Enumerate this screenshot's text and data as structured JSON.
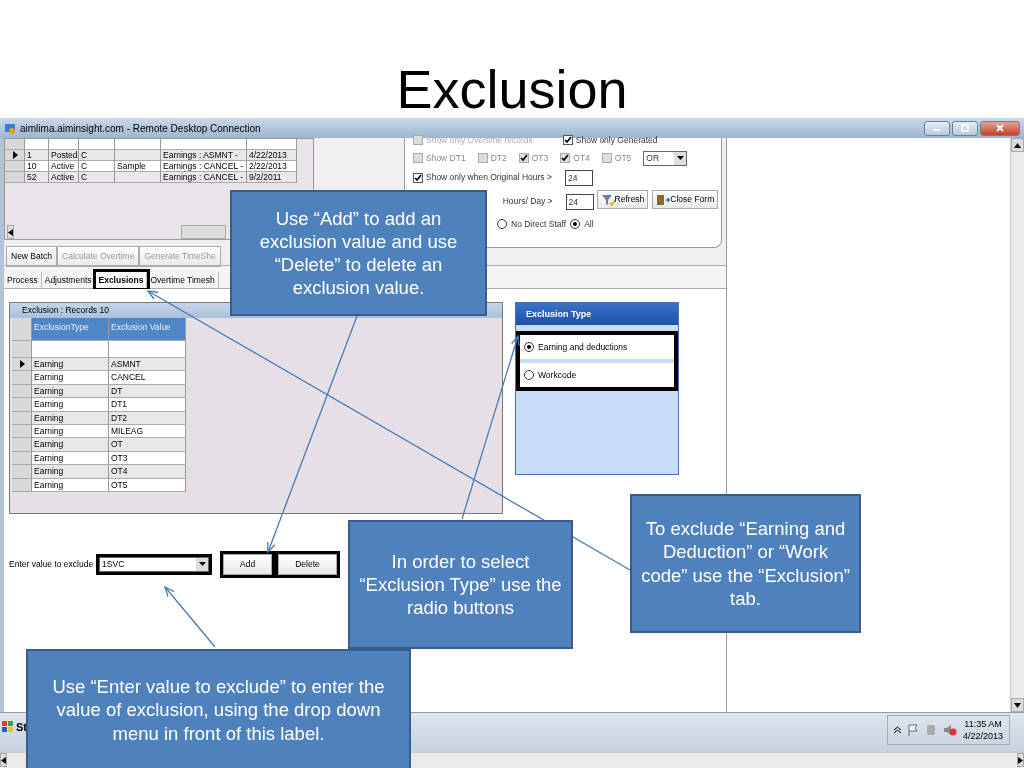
{
  "slide_title": "Exclusion",
  "window": {
    "title": "aimlima.aiminsight.com - Remote Desktop Connection"
  },
  "batch_grid": {
    "rows": [
      {
        "cells": [
          "1",
          "Posted",
          "C",
          "",
          "Earnings : ASMNT -",
          "4/22/2013"
        ],
        "selected": true
      },
      {
        "cells": [
          "10",
          "Active",
          "C",
          "Sample",
          "Earnings : CANCEL -",
          "2/22/2013"
        ],
        "selected": false
      },
      {
        "cells": [
          "52",
          "Active",
          "C",
          "",
          "Earnings : CANCEL -",
          "9/2/2011"
        ],
        "selected": false
      }
    ]
  },
  "batch_buttons": [
    {
      "label": "New Batch",
      "disabled": false
    },
    {
      "label": "Calculate Overtime",
      "disabled": true
    },
    {
      "label": "Generate TimeShe",
      "disabled": true
    }
  ],
  "filters": {
    "row1": [
      {
        "label": "Show only Overtime records",
        "checked": false,
        "disabled": true
      },
      {
        "label": "Show only Generated",
        "checked": true,
        "disabled": false
      }
    ],
    "row2": [
      {
        "label": "Show DT1",
        "checked": false
      },
      {
        "label": "DT2",
        "checked": false
      },
      {
        "label": "OT3",
        "checked": true
      },
      {
        "label": "OT4",
        "checked": true
      },
      {
        "label": "OT5",
        "checked": false
      }
    ],
    "operator": "OR",
    "original_hours": {
      "label": "Show only when Original Hours >",
      "checked": true,
      "value": "24"
    },
    "hours_day": {
      "label": "Hours/ Day >",
      "value": "24"
    },
    "refresh": "Refresh",
    "close_form": "Close Form",
    "staff": [
      {
        "label": "No Direct Staff",
        "selected": false
      },
      {
        "label": "All",
        "selected": true
      }
    ]
  },
  "tabs": [
    {
      "label": "Process",
      "selected": false,
      "highlighted": false
    },
    {
      "label": "Adjustments",
      "selected": false,
      "highlighted": false
    },
    {
      "label": "Exclusions",
      "selected": true,
      "highlighted": true
    },
    {
      "label": "Overtime Timesh",
      "selected": false,
      "highlighted": false
    }
  ],
  "exclusion_grid": {
    "title": "Exclusion : Records 10",
    "columns": [
      "ExclusionType",
      "Exclusion Value"
    ],
    "rows": [
      {
        "type": "Earning",
        "value": "ASMNT",
        "selected": true
      },
      {
        "type": "Earning",
        "value": "CANCEL",
        "selected": false
      },
      {
        "type": "Earning",
        "value": "DT",
        "selected": false
      },
      {
        "type": "Earning",
        "value": "DT1",
        "selected": false
      },
      {
        "type": "Earning",
        "value": "DT2",
        "selected": false
      },
      {
        "type": "Earning",
        "value": "MILEAG",
        "selected": false
      },
      {
        "type": "Earning",
        "value": "OT",
        "selected": false
      },
      {
        "type": "Earning",
        "value": "OT3",
        "selected": false
      },
      {
        "type": "Earning",
        "value": "OT4",
        "selected": false
      },
      {
        "type": "Earning",
        "value": "OT5",
        "selected": false
      }
    ]
  },
  "exclusion_type": {
    "title": "Exclusion Type",
    "highlighted": true,
    "options": [
      {
        "label": "Earning and deductions",
        "selected": true
      },
      {
        "label": "Workcode",
        "selected": false
      }
    ]
  },
  "entry": {
    "label": "Enter value to exclude",
    "value": "1SVC",
    "highlighted": true
  },
  "buttons": [
    {
      "label": "Add",
      "highlighted": true
    },
    {
      "label": "Delete",
      "highlighted": true
    }
  ],
  "taskbar": {
    "start": "St",
    "time": "11:35 AM",
    "date": "4/22/2013"
  },
  "callouts": [
    {
      "text": "Use “Add” to add an exclusion value and use “Delete” to delete an exclusion value."
    },
    {
      "text": "In order to select “Exclusion Type” use the radio buttons"
    },
    {
      "text": "To exclude “Earning and Deduction” or “Work code” use the “Exclusion” tab."
    },
    {
      "text": "Use “Enter value to exclude” to enter the value of exclusion, using the drop down menu in front of this label."
    }
  ]
}
